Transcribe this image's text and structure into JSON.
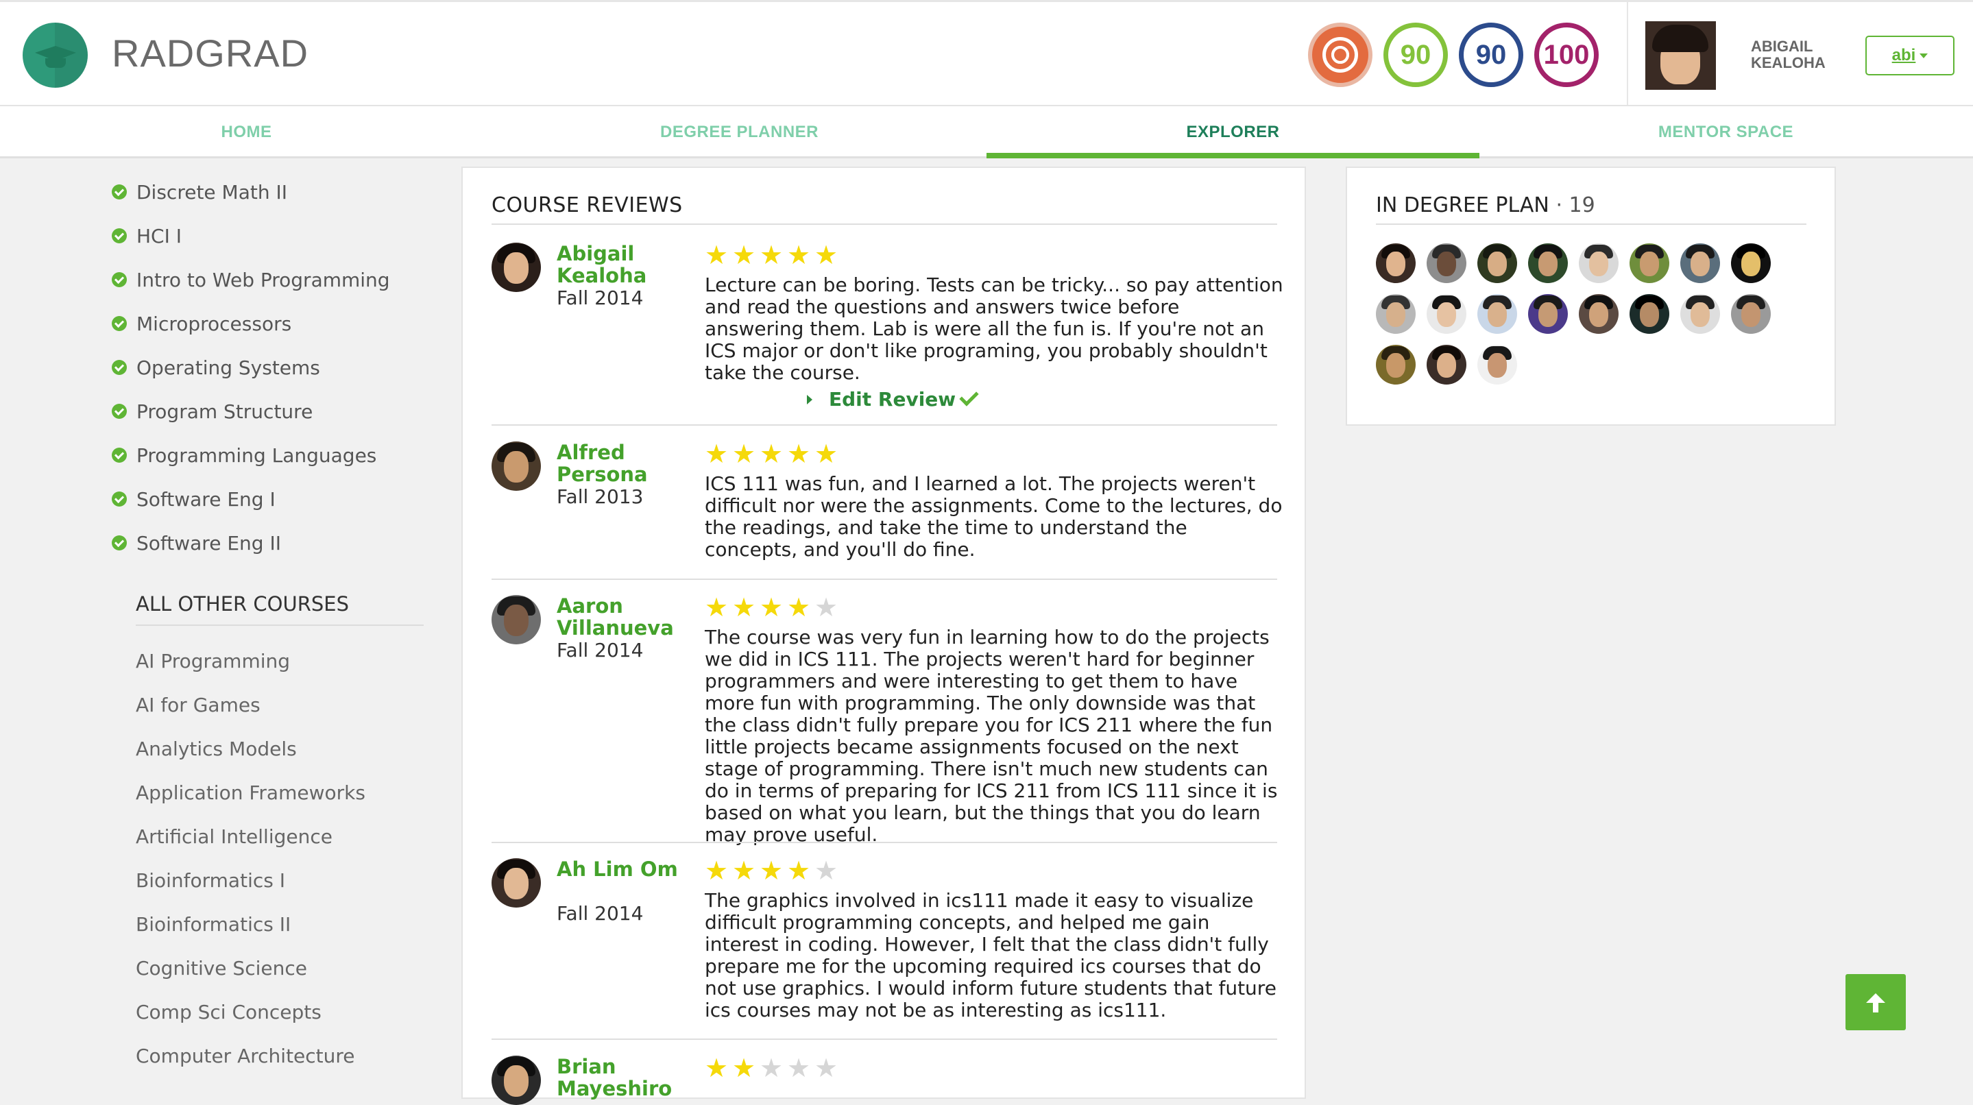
{
  "app": {
    "brand": "RADGRAD"
  },
  "header": {
    "badges": [
      "90",
      "90",
      "100"
    ],
    "user_name": "ABIGAIL KEALOHA",
    "user_button": "abi"
  },
  "nav": {
    "tabs": [
      "HOME",
      "DEGREE PLANNER",
      "EXPLORER",
      "MENTOR SPACE"
    ],
    "active": "EXPLORER"
  },
  "sidebar": {
    "completed": [
      "Discrete Math II",
      "HCI I",
      "Intro to Web Programming",
      "Microprocessors",
      "Operating Systems",
      "Program Structure",
      "Programming Languages",
      "Software Eng I",
      "Software Eng II"
    ],
    "other_title": "ALL OTHER COURSES",
    "other": [
      "AI Programming",
      "AI for Games",
      "Analytics Models",
      "Application Frameworks",
      "Artificial Intelligence",
      "Bioinformatics I",
      "Bioinformatics II",
      "Cognitive Science",
      "Comp Sci Concepts",
      "Computer Architecture"
    ]
  },
  "reviews": {
    "title": "COURSE REVIEWS",
    "edit_label": "Edit Review",
    "items": [
      {
        "name": "Abigail Kealoha",
        "term": "Fall 2014",
        "stars": 5,
        "text": "Lecture can be boring. Tests can be tricky... so pay attention and read the questions and answers twice before answering them. Lab is were all the fun is. If you're not an ICS major or don't like programing, you probably shouldn't take the course."
      },
      {
        "name": "Alfred Persona",
        "term": "Fall 2013",
        "stars": 5,
        "text": "ICS 111 was fun, and I learned a lot. The projects weren't difficult nor were the assignments. Come to the lectures, do the readings, and take the time to understand the concepts, and you'll do fine."
      },
      {
        "name": "Aaron Villanueva",
        "term": "Fall 2014",
        "stars": 4,
        "text": "The course was very fun in learning how to do the projects we did in ICS 111. The projects weren't hard for beginner programmers and were interesting to get them to have more fun with programming. The only downside was that the class didn't fully prepare you for ICS 211 where the fun little projects became assignments focused on the next stage of programming. There isn't much new students can do in terms of preparing for ICS 211 from ICS 111 since it is based on what you learn, but the things that you do learn may prove useful."
      },
      {
        "name": "Ah Lim Om",
        "term": "Fall 2014",
        "stars": 4,
        "text": "The graphics involved in ics111 made it easy to visualize difficult programming concepts, and helped me gain interest in coding. However, I felt that the class didn't fully prepare me for the upcoming required ics courses that do not use graphics. I would inform future students that future ics courses may not be as interesting as ics111."
      },
      {
        "name": "Brian Mayeshiro",
        "term": "",
        "stars": 2,
        "text": ""
      }
    ]
  },
  "plan": {
    "title": "IN DEGREE PLAN",
    "count": "· 19"
  },
  "colors": {
    "accent": "#5fb535",
    "brand": "#2e9a7a",
    "nav_active": "#1e7f5a",
    "nav_inactive": "#7fcfaa",
    "name_green": "#44a12b"
  }
}
